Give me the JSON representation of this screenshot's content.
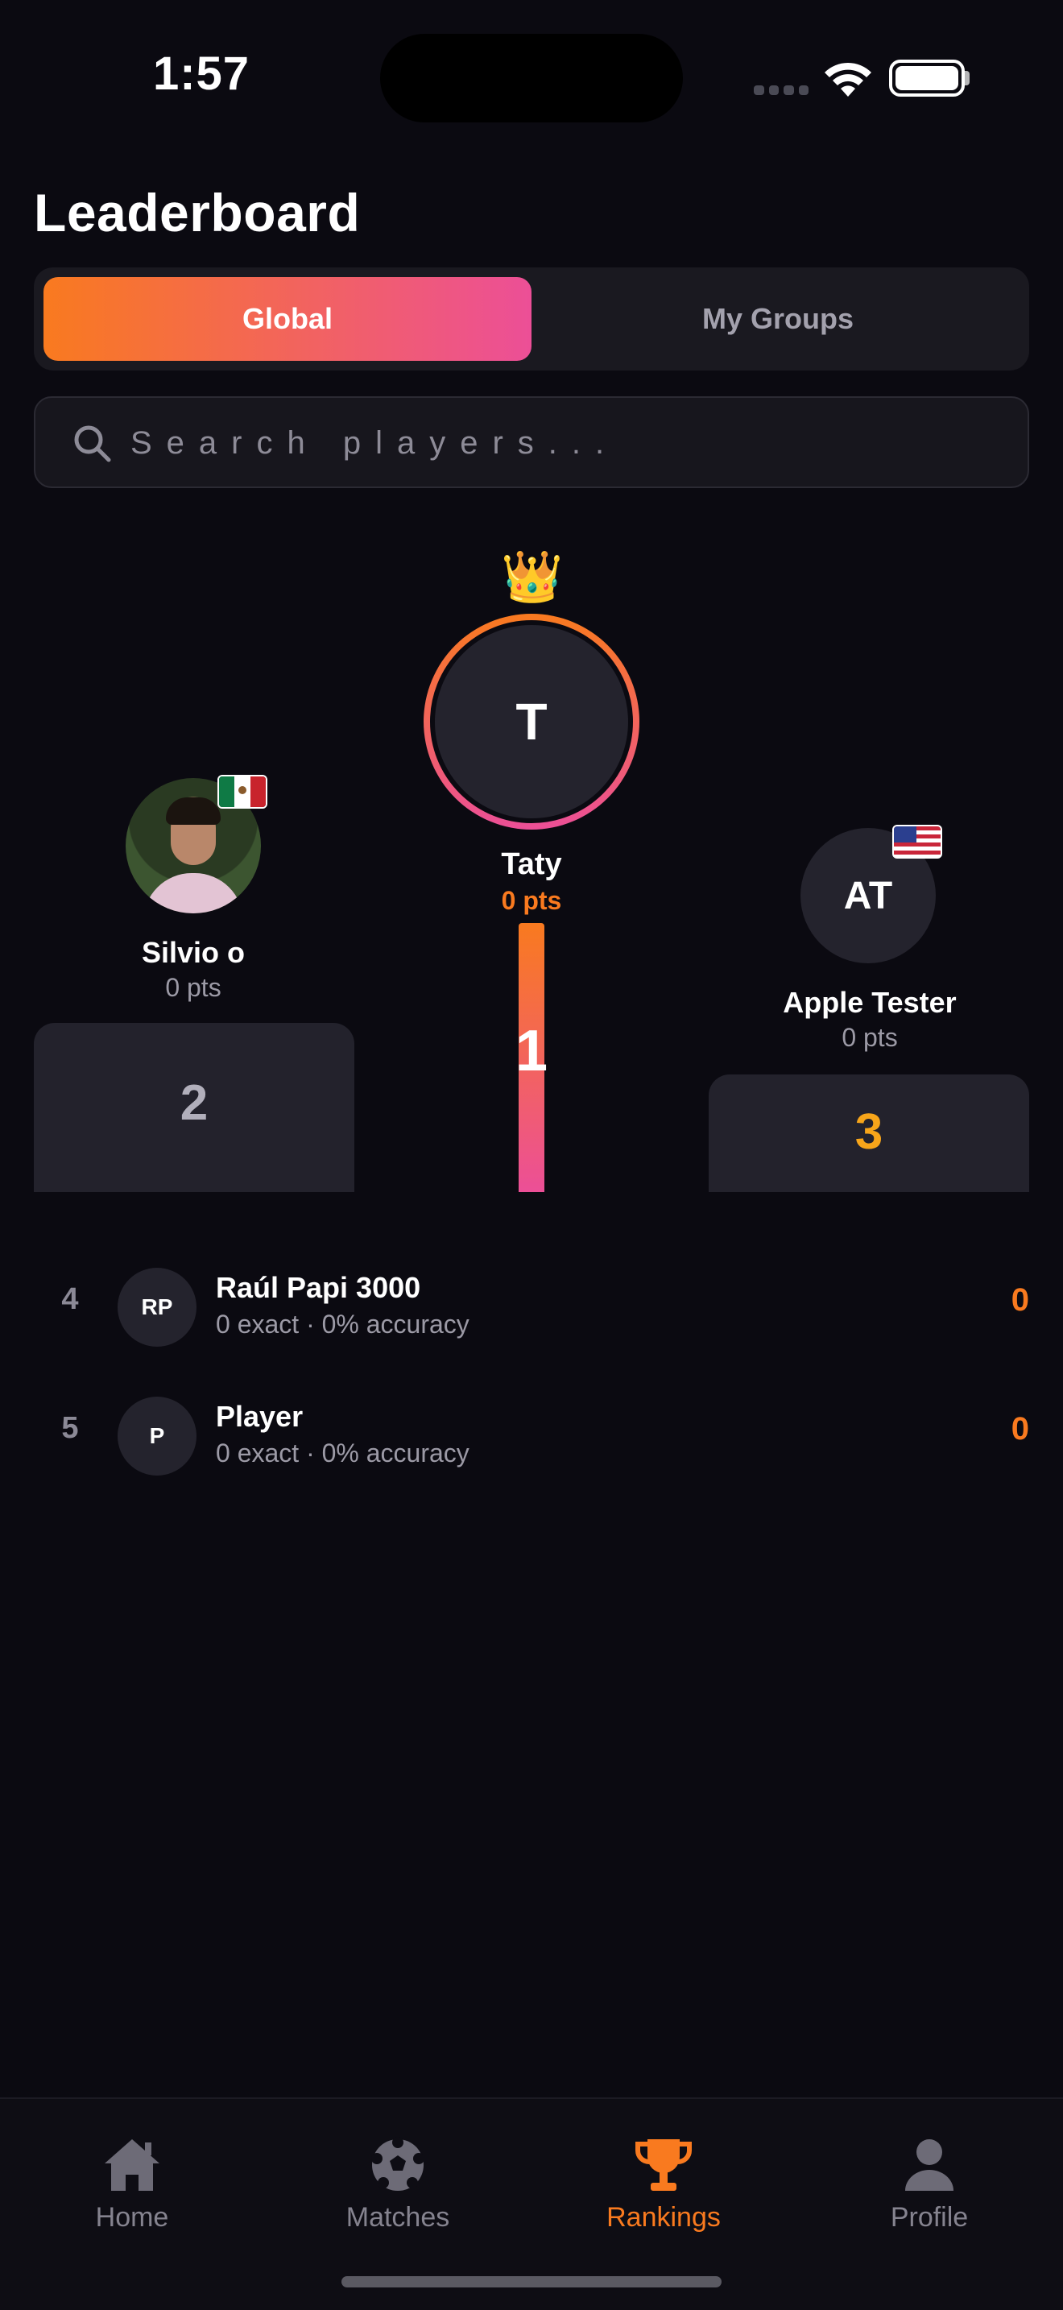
{
  "status_bar": {
    "time": "1:57"
  },
  "header": {
    "title": "Leaderboard"
  },
  "segment": {
    "global_label": "Global",
    "groups_label": "My Groups"
  },
  "search": {
    "placeholder": "Search players..."
  },
  "podium": {
    "first": {
      "rank": "1",
      "initials": "T",
      "name": "Taty",
      "points": "0 pts",
      "badge": "👑"
    },
    "second": {
      "rank": "2",
      "name": "Silvio o",
      "points": "0 pts",
      "flag": "mexico-flag"
    },
    "third": {
      "rank": "3",
      "initials": "AT",
      "name": "Apple Tester",
      "points": "0 pts",
      "flag": "usa-flag"
    }
  },
  "rankings": [
    {
      "rank": "4",
      "initials": "RP",
      "name": "Raúl Papi 3000",
      "stats": "0 exact · 0% accuracy",
      "points": "0"
    },
    {
      "rank": "5",
      "initials": "P",
      "name": "Player",
      "stats": "0 exact · 0% accuracy",
      "points": "0"
    }
  ],
  "tabs": [
    {
      "label": "Home",
      "icon": "home-icon"
    },
    {
      "label": "Matches",
      "icon": "soccer-ball-icon"
    },
    {
      "label": "Rankings",
      "icon": "trophy-icon",
      "active": true
    },
    {
      "label": "Profile",
      "icon": "person-icon"
    }
  ],
  "colors": {
    "accent_start": "#f97a1f",
    "accent_end": "#ec4f97",
    "gold": "#f7a51a",
    "background": "#0b0a11"
  }
}
